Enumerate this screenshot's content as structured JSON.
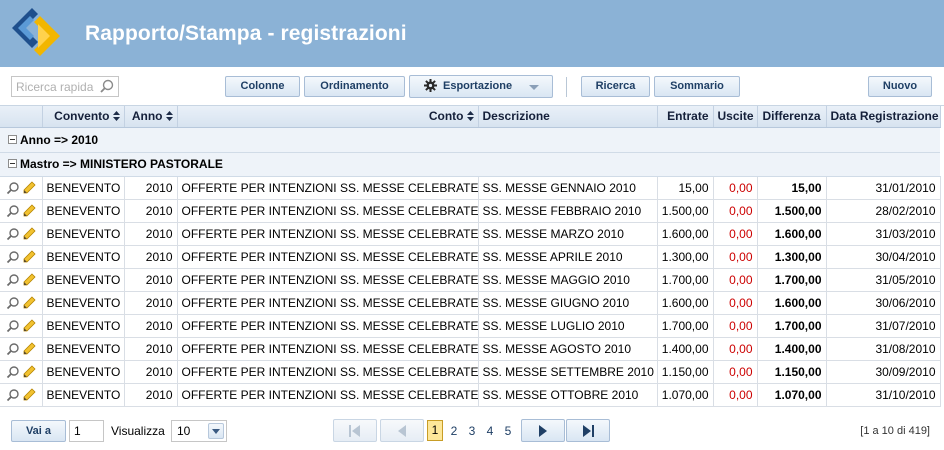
{
  "app": {
    "title": "Rapporto/Stampa - registrazioni"
  },
  "toolbar": {
    "search_placeholder": "Ricerca rapida",
    "columns_label": "Colonne",
    "sort_label": "Ordinamento",
    "export_label": "Esportazione",
    "search_label": "Ricerca",
    "summary_label": "Sommario",
    "new_label": "Nuovo"
  },
  "table": {
    "headers": {
      "convent": "Convento",
      "year": "Anno",
      "account": "Conto",
      "description": "Descrizione",
      "income": "Entrate",
      "expense": "Uscite",
      "difference": "Differenza",
      "date": "Data Registrazione"
    },
    "group_year": "Anno => 2010",
    "group_ledger": "Mastro => MINISTERO PASTORALE",
    "rows": [
      {
        "convent": "BENEVENTO",
        "year": "2010",
        "account": "OFFERTE PER INTENZIONI SS. MESSE CELEBRATE",
        "description": "SS. MESSE GENNAIO 2010",
        "income": "15,00",
        "expense": "0,00",
        "difference": "15,00",
        "date": "31/01/2010"
      },
      {
        "convent": "BENEVENTO",
        "year": "2010",
        "account": "OFFERTE PER INTENZIONI SS. MESSE CELEBRATE",
        "description": "SS. MESSE FEBBRAIO 2010",
        "income": "1.500,00",
        "expense": "0,00",
        "difference": "1.500,00",
        "date": "28/02/2010"
      },
      {
        "convent": "BENEVENTO",
        "year": "2010",
        "account": "OFFERTE PER INTENZIONI SS. MESSE CELEBRATE",
        "description": "SS. MESSE MARZO 2010",
        "income": "1.600,00",
        "expense": "0,00",
        "difference": "1.600,00",
        "date": "31/03/2010"
      },
      {
        "convent": "BENEVENTO",
        "year": "2010",
        "account": "OFFERTE PER INTENZIONI SS. MESSE CELEBRATE",
        "description": "SS. MESSE APRILE 2010",
        "income": "1.300,00",
        "expense": "0,00",
        "difference": "1.300,00",
        "date": "30/04/2010"
      },
      {
        "convent": "BENEVENTO",
        "year": "2010",
        "account": "OFFERTE PER INTENZIONI SS. MESSE CELEBRATE",
        "description": "SS. MESSE MAGGIO 2010",
        "income": "1.700,00",
        "expense": "0,00",
        "difference": "1.700,00",
        "date": "31/05/2010"
      },
      {
        "convent": "BENEVENTO",
        "year": "2010",
        "account": "OFFERTE PER INTENZIONI SS. MESSE CELEBRATE",
        "description": "SS. MESSE GIUGNO 2010",
        "income": "1.600,00",
        "expense": "0,00",
        "difference": "1.600,00",
        "date": "30/06/2010"
      },
      {
        "convent": "BENEVENTO",
        "year": "2010",
        "account": "OFFERTE PER INTENZIONI SS. MESSE CELEBRATE",
        "description": "SS. MESSE LUGLIO 2010",
        "income": "1.700,00",
        "expense": "0,00",
        "difference": "1.700,00",
        "date": "31/07/2010"
      },
      {
        "convent": "BENEVENTO",
        "year": "2010",
        "account": "OFFERTE PER INTENZIONI SS. MESSE CELEBRATE",
        "description": "SS. MESSE AGOSTO 2010",
        "income": "1.400,00",
        "expense": "0,00",
        "difference": "1.400,00",
        "date": "31/08/2010"
      },
      {
        "convent": "BENEVENTO",
        "year": "2010",
        "account": "OFFERTE PER INTENZIONI SS. MESSE CELEBRATE",
        "description": "SS. MESSE SETTEMBRE 2010",
        "income": "1.150,00",
        "expense": "0,00",
        "difference": "1.150,00",
        "date": "30/09/2010"
      },
      {
        "convent": "BENEVENTO",
        "year": "2010",
        "account": "OFFERTE PER INTENZIONI SS. MESSE CELEBRATE",
        "description": "SS. MESSE OTTOBRE 2010",
        "income": "1.070,00",
        "expense": "0,00",
        "difference": "1.070,00",
        "date": "31/10/2010"
      }
    ]
  },
  "pager": {
    "goto_label": "Vai a",
    "goto_value": "1",
    "per_page_label": "Visualizza",
    "per_page_value": "10",
    "pages": [
      "1",
      "2",
      "3",
      "4",
      "5"
    ],
    "current_page": "1",
    "info": "[1 a 10 di 419]"
  },
  "colors": {
    "header_bg": "#8bb2d6",
    "negative": "#cc0000",
    "current_page_bg": "#fde79a"
  },
  "icons": {
    "logo": "arrow-logo-icon",
    "search": "search-icon",
    "export": "gear-icon",
    "view": "magnifier-icon",
    "edit": "pencil-icon"
  }
}
